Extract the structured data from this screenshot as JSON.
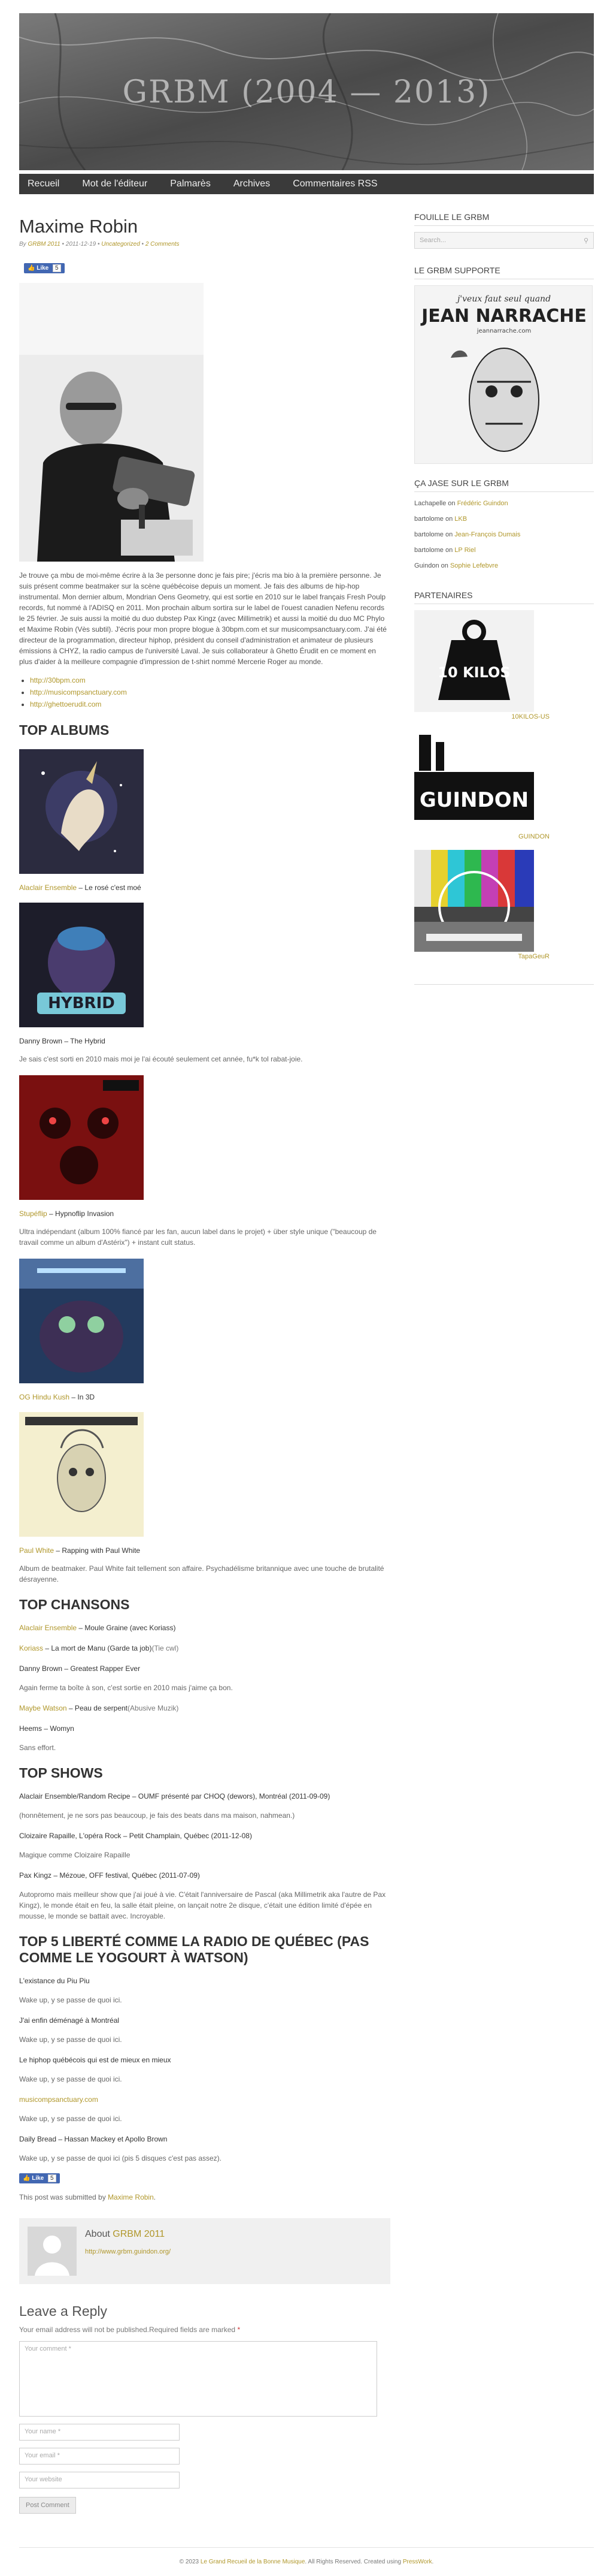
{
  "site": {
    "title": "GRBM (2004 — 2013)"
  },
  "nav": [
    "Recueil",
    "Mot de l'éditeur",
    "Palmarès",
    "Archives",
    "Commentaires RSS"
  ],
  "post": {
    "title": "Maxime Robin",
    "meta": {
      "by": "By",
      "author": "GRBM 2011",
      "date": "• 2011-12-19 •",
      "category": "Uncategorized",
      "sep": "•",
      "comments": "2 Comments"
    },
    "fb": {
      "label": "Like",
      "count": "5"
    },
    "intro": "Je trouve ça mbu de moi-même écrire à la 3e personne donc je fais pire; j'écris ma bio à la première personne. Je suis présent comme beatmaker sur la scène québécoise depuis un moment. Je fais des albums de hip-hop instrumental. Mon dernier album, Mondrian Oens Geometry, qui est sortie en 2010 sur le label français Fresh Poulp records, fut nommé à l'ADISQ en 2011. Mon prochain album sortira sur le label de l'ouest canadien Nefenu records le 25 février. Je suis aussi la moitié du duo dubstep Pax Kingz (avec Millimetrik) et aussi la moitié du duo MC Phylo et Maxime Robin (Vès subtil). J'écris pour mon propre blogue à 30bpm.com et sur musicompsanctuary.com. J'ai été directeur de la programmation, directeur hiphop, président du conseil d'administration et animateur de plusieurs émissions à CHYZ, la radio campus de l'université Laval. Je suis collaborateur à Ghetto Érudit en ce moment en plus d'aider à la meilleure compagnie d'impression de t-shirt nommé Mercerie Roger au monde.",
    "links": [
      "http://30bpm.com",
      "http://musicompsanctuary.com",
      "http://ghettoerudit.com"
    ],
    "top_albums": {
      "heading": "Top albums",
      "items": [
        {
          "artist": "Alaclair Ensemble",
          "title": " – Le rosé c'est moé",
          "artist_linked": true,
          "note": ""
        },
        {
          "artist": "",
          "title": "Danny Brown – The Hybrid",
          "artist_linked": false,
          "note": "Je sais c'est sorti en 2010 mais moi je l'ai écouté seulement cet année, fu*k tol rabat-joie."
        },
        {
          "artist": "Stupéflip",
          "title": " – Hypnoflip Invasion",
          "artist_linked": true,
          "note": "Ultra indépendant (album 100% fiancé par les fan, aucun label dans le projet) + über style unique (\"beaucoup de travail comme un album d'Astérix\") + instant cult status."
        },
        {
          "artist": "OG Hindu Kush",
          "title": " – In 3D",
          "artist_linked": true,
          "note": ""
        },
        {
          "artist": "Paul White",
          "title": " – Rapping with Paul White",
          "artist_linked": true,
          "note": "Album de beatmaker. Paul White fait tellement son affaire. Psychadélisme britannique avec une touche de brutalité désrayenne."
        }
      ]
    },
    "top_chansons": {
      "heading": "Top chansons",
      "items": [
        {
          "artist": "Alaclair Ensemble",
          "rest": " – Moule Graine (avec Koriass)",
          "extra": ""
        },
        {
          "artist": "Koriass",
          "rest": " – La mort de Manu (Garde ta job)",
          "extra": "(Tie cwl)"
        },
        {
          "artist": "",
          "rest": "Danny Brown – Greatest Rapper Ever",
          "extra": ""
        }
      ],
      "note1": "Again ferme ta boîte à son, c'est sortie en 2010 mais j'aime ça bon.",
      "items2": [
        {
          "artist": "Maybe Watson",
          "rest": " – Peau de serpent",
          "extra": "(Abusive Muzik)"
        },
        {
          "artist": "",
          "rest": "Heems – Womyn",
          "extra": ""
        }
      ],
      "note2": "Sans effort."
    },
    "top_shows": {
      "heading": "Top shows",
      "items": [
        {
          "line": "Alaclair Ensemble/Random Recipe – OUMF présenté par CHOQ (dewors), Montréal (2011-09-09)",
          "note": "(honnêtement, je ne sors pas beaucoup, je fais des beats dans ma maison, nahmean.)"
        },
        {
          "line": "Cloizaire Rapaille, L'opéra Rock – Petit Champlain, Québec (2011-12-08)",
          "note": "Magique comme Cloizaire Rapaille"
        },
        {
          "line": "Pax Kingz – Mézoue, OFF festival, Québec (2011-07-09)",
          "note": "Autopromo mais meilleur show que j'ai joué à vie. C'était l'anniversaire de Pascal (aka Millimetrik aka l'autre de Pax Kingz), le monde était en feu, la salle était pleine, on lançait notre 2e disque, c'était une édition limité d'épée en mousse, le monde se battait avec. Incroyable."
        }
      ]
    },
    "top_radio": {
      "heading": "Top 5 liberté comme la radio de Québec (pas comme le yogourt à Watson)",
      "items": [
        {
          "line": "L'existance du Piu Piu",
          "linked": false,
          "note": "Wake up, y se passe de quoi ici."
        },
        {
          "line": "J'ai enfin déménagé à Montréal",
          "linked": false,
          "note": "Wake up, y se passe de quoi ici."
        },
        {
          "line": "Le hiphop québécois qui est de mieux en mieux",
          "linked": false,
          "note": "Wake up, y se passe de quoi ici."
        },
        {
          "line": "musicompsanctuary.com",
          "linked": true,
          "note": "Wake up, y se passe de quoi ici."
        },
        {
          "line": "Daily Bread – Hassan Mackey et Apollo Brown",
          "linked": false,
          "note": "Wake up, y se passe de quoi ici (pis 5 disques c'est pas assez)."
        }
      ]
    },
    "submitted": {
      "prefix": "This post was submitted by ",
      "author": "Maxime Robin",
      "suffix": "."
    },
    "author_box": {
      "about": "About ",
      "name": "GRBM 2011",
      "url": "http://www.grbm.guindon.org/"
    }
  },
  "reply": {
    "heading": "Leave a Reply",
    "note": "Your email address will not be published.Required fields are marked",
    "required_mark": "*",
    "comment_placeholder": "Your comment *",
    "name_placeholder": "Your name *",
    "email_placeholder": "Your email *",
    "website_placeholder": "Your website",
    "submit": "Post Comment"
  },
  "sidebar": {
    "search": {
      "title": "Fouille le GRBM",
      "placeholder": "Search..."
    },
    "supporte": {
      "title": "Le GRBM supporte",
      "poster_line1": "j'veux faut seul quand",
      "poster_name": "JEAN NARRACHE",
      "poster_site": "jeannarrache.com"
    },
    "jase": {
      "title": "Ça jase sur le GRBM",
      "items": [
        {
          "who": "Lachapelle",
          "on": " on ",
          "what": "Frédéric Guindon"
        },
        {
          "who": "bartolome",
          "on": " on ",
          "what": "LKB"
        },
        {
          "who": "bartolome",
          "on": " on ",
          "what": "Jean-François Dumais"
        },
        {
          "who": "bartolome",
          "on": " on ",
          "what": "LP Riel"
        },
        {
          "who": "Guindon",
          "on": " on ",
          "what": "Sophie Lefebvre"
        }
      ]
    },
    "partners": {
      "title": "Partenaires",
      "items": [
        {
          "name": "10KILOS-US",
          "logo_text": "10 KILOS"
        },
        {
          "name": "GUINDON",
          "logo_text": "GUINDON"
        },
        {
          "name": "TapaGeuR",
          "logo_text": ""
        }
      ]
    }
  },
  "footer": {
    "copy": "© 2023 ",
    "site_link": "Le Grand Recueil de la Bonne Musique",
    "rights": ". All Rights Reserved. Created using ",
    "theme_link": "PressWork",
    "end": "."
  }
}
